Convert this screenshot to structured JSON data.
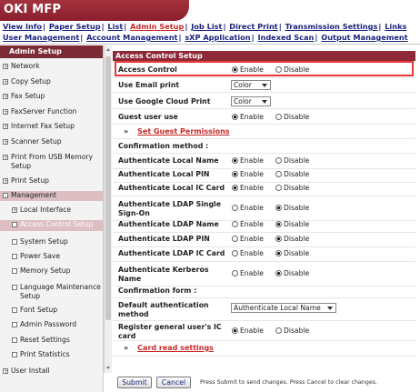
{
  "app": {
    "title": "OKI MFP"
  },
  "nav": {
    "row1": [
      {
        "label": "View Info",
        "active": false
      },
      {
        "label": "Paper Setup",
        "active": false
      },
      {
        "label": "List",
        "active": false
      },
      {
        "label": "Admin Setup",
        "active": true
      },
      {
        "label": "Job List",
        "active": false
      },
      {
        "label": "Direct Print",
        "active": false
      },
      {
        "label": "Transmission Settings",
        "active": false
      },
      {
        "label": "Links",
        "active": false
      }
    ],
    "row2": [
      {
        "label": "User Management"
      },
      {
        "label": "Account Management"
      },
      {
        "label": "sXP Application"
      },
      {
        "label": "Indexed Scan"
      },
      {
        "label": "Output Management"
      }
    ]
  },
  "sidebar": {
    "title": "Admin Setup",
    "items": [
      {
        "label": "Network",
        "icon": "plus"
      },
      {
        "label": "Copy Setup",
        "icon": "plus"
      },
      {
        "label": "Fax Setup",
        "icon": "plus"
      },
      {
        "label": "FaxServer Function",
        "icon": "plus"
      },
      {
        "label": "Internet Fax Setup",
        "icon": "plus"
      },
      {
        "label": "Scanner Setup",
        "icon": "plus"
      },
      {
        "label": "Print From USB Memory Setup",
        "icon": "plus"
      },
      {
        "label": "Print Setup",
        "icon": "plus"
      },
      {
        "label": "Management",
        "icon": "minus"
      },
      {
        "label": "Local Interface",
        "icon": "plus"
      },
      {
        "label": "Access Control Setup",
        "icon": "square"
      },
      {
        "label": "System Setup",
        "icon": "square"
      },
      {
        "label": "Power Save",
        "icon": "square"
      },
      {
        "label": "Memory Setup",
        "icon": "square"
      },
      {
        "label": "Language Maintenance Setup",
        "icon": "square"
      },
      {
        "label": "Font Setup",
        "icon": "square"
      },
      {
        "label": "Admin Password",
        "icon": "square"
      },
      {
        "label": "Reset Settings",
        "icon": "square"
      },
      {
        "label": "Print Statistics",
        "icon": "square"
      },
      {
        "label": "User Install",
        "icon": "plus"
      }
    ]
  },
  "main": {
    "section_title": "Access Control Setup",
    "enable_label": "Enable",
    "disable_label": "Disable",
    "access_control": {
      "label": "Access Control",
      "value": "Enable"
    },
    "use_email_print": {
      "label": "Use Email print",
      "value": "Color"
    },
    "use_google_cloud_print": {
      "label": "Use Google Cloud Print",
      "value": "Color"
    },
    "guest_user_use": {
      "label": "Guest user use",
      "value": "Enable"
    },
    "set_guest_permissions": "Set Guest Permissions",
    "confirmation_method_header": "Confirmation method :",
    "methods": [
      {
        "label": "Authenticate Local Name",
        "value": "Enable"
      },
      {
        "label": "Authenticate Local PIN",
        "value": "Enable"
      },
      {
        "label": "Authenticate Local IC Card",
        "value": "Enable"
      },
      {
        "label": "Authenticate LDAP Single Sign-On",
        "value": "Disable"
      },
      {
        "label": "Authenticate LDAP Name",
        "value": "Disable"
      },
      {
        "label": "Authenticate LDAP PIN",
        "value": "Disable"
      },
      {
        "label": "Authenticate LDAP IC Card",
        "value": "Disable"
      },
      {
        "label": "Authenticate Kerberos Name",
        "value": "Disable"
      }
    ],
    "confirmation_form_header": "Confirmation form :",
    "default_auth": {
      "label": "Default authentication method",
      "value": "Authenticate Local Name"
    },
    "register_ic": {
      "label": "Register general user's IC card",
      "value": "Enable"
    },
    "card_read_settings": "Card read settings"
  },
  "buttons": {
    "submit": "Submit",
    "cancel": "Cancel"
  },
  "footer_note": "Press Submit to send changes. Press Cancel to clear changes.",
  "colors": {
    "brand": "#8a1f2d",
    "highlight": "#e53935",
    "link": "#1a237e"
  }
}
